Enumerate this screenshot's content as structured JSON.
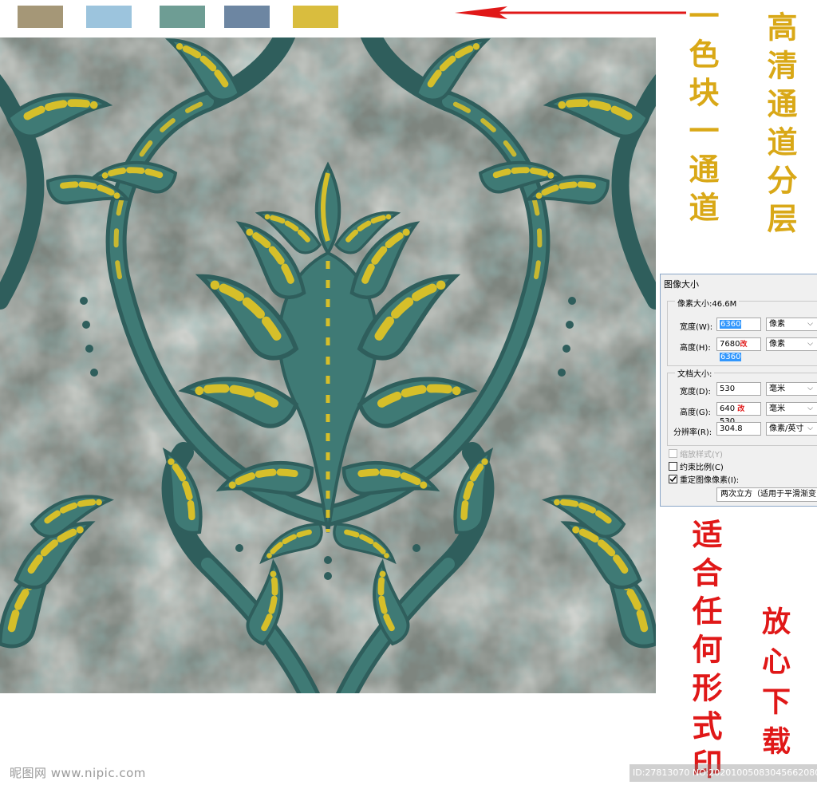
{
  "swatches": [
    "#a59777",
    "#9cc4dd",
    "#6e9d94",
    "#6d86a2",
    "#d9bd3e"
  ],
  "pattern_colors": {
    "base": "#7e857f",
    "light": "#b9bcb6",
    "teal": "#3f7a75",
    "dark_teal": "#2f5e5c",
    "gold": "#d6bf2a"
  },
  "left_vertical_text": "一色块一通道",
  "right_vertical_text": "高清通道分层",
  "red_text_1": "适合任何形式印",
  "red_text_2": "放心下载",
  "dialog": {
    "title": "图像大小",
    "pixel_size_label": "像素大小:46.6M",
    "width_label": "宽度(W):",
    "width_value": "6360",
    "height_label": "高度(H):",
    "height_old": "7680",
    "height_mark": "改",
    "height_new": "6360",
    "unit_pixels": "像素",
    "doc_size_label": "文档大小:",
    "doc_width_label": "宽度(D):",
    "doc_width_value": "530",
    "doc_height_label": "高度(G):",
    "doc_height_old": "640",
    "doc_height_mark": "改",
    "doc_height_new": "530",
    "unit_mm": "毫米",
    "resolution_label": "分辨率(R):",
    "resolution_value": "304.8",
    "unit_ppi": "像素/英寸",
    "scale_styles": "缩放样式(Y)",
    "constrain": "约束比例(C)",
    "resample": "重定图像像素(I):",
    "resample_method": "两次立方（适用于平滑渐变"
  },
  "watermark_left": "昵图网 www.nipic.com",
  "watermark_right": "ID:27813070 NO:20201005083045662080"
}
